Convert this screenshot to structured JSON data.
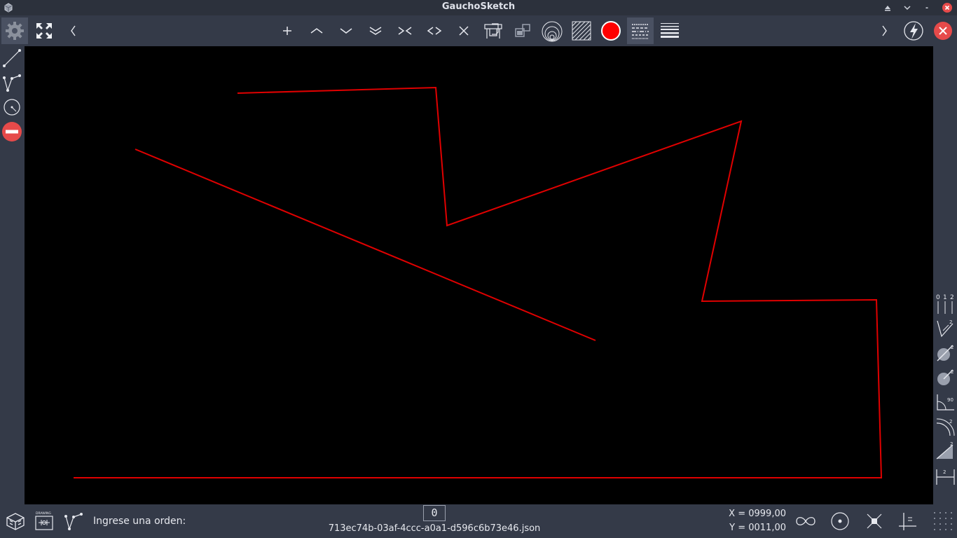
{
  "window": {
    "title": "GauchoSketch",
    "icons": {
      "app": "cube-app-icon",
      "shade": "shade-icon",
      "minimize": "minimize-icon",
      "maximize": "maximize-icon",
      "close": "close-icon"
    },
    "close_color": "#e64a4a"
  },
  "toolbar": {
    "left_icons": [
      "gear-icon",
      "expand-icon",
      "chevron-left-icon"
    ],
    "center_glyphs": {
      "plus": "+",
      "arc_up": "︿",
      "arc_down": "﹀",
      "double_down": "︾",
      "converge": ">‹",
      "diverge": "‹>",
      "cross": "×"
    },
    "right_icons": [
      "chevron-right-icon",
      "lightning-icon",
      "close-circle-icon"
    ],
    "record_color": "#ff0000"
  },
  "left_tools": [
    "line-tool-icon",
    "polyline-tool-icon",
    "circle-tool-icon",
    "no-entry-icon"
  ],
  "right_tools": {
    "layer_labels": "0 1 2",
    "icons": [
      "layers-icon",
      "angle-measure-icon",
      "diameter-icon",
      "radius-icon",
      "angle-90-icon",
      "arc-length-icon",
      "slope-icon",
      "linear-dimension-icon"
    ]
  },
  "drawing": {
    "stroke_color": "#e00000",
    "background": "#000000"
  },
  "statusbar": {
    "prompt": "Ingrese una orden:",
    "counter": "0",
    "filename": "713ec74b-03af-4ccc-a0a1-d596c6b73e46.json",
    "x_coord": "X = 0999,00",
    "y_coord": "Y = 0011,00",
    "drawing_badge": "DRAWING"
  }
}
